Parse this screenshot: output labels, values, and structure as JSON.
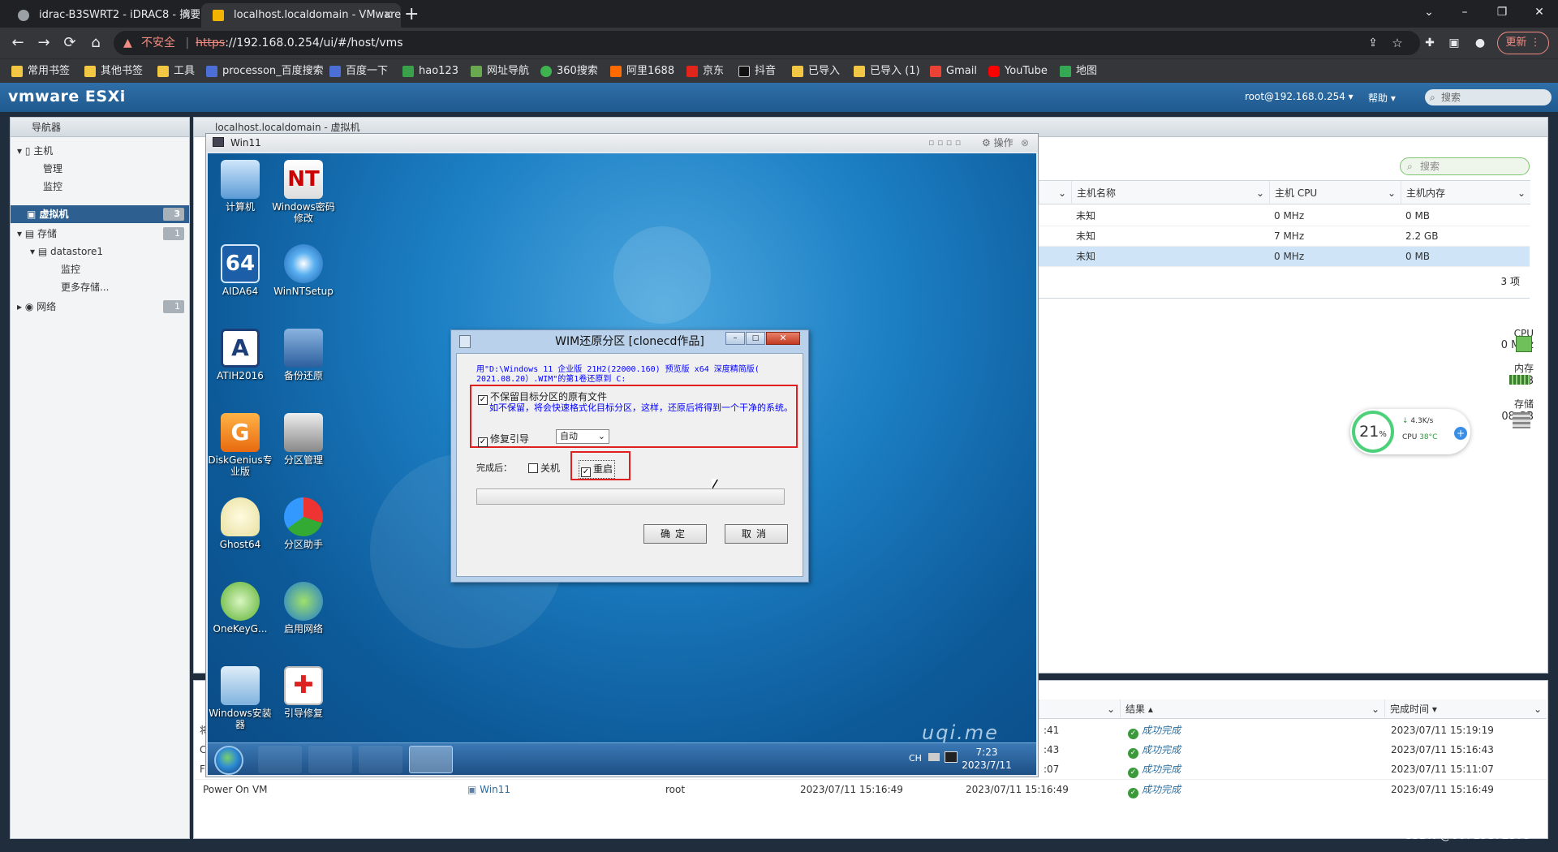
{
  "browser": {
    "tabs": [
      {
        "title": "idrac-B3SWRT2 - iDRAC8 - 摘要"
      },
      {
        "title": "localhost.localdomain - VMware ESXi"
      }
    ],
    "new_tab_label": "+",
    "window_controls": {
      "minimize": "–",
      "maximize": "❐",
      "close": "✕"
    },
    "nav": {
      "back": "←",
      "forward": "→",
      "reload": "⟳",
      "home": "⌂"
    },
    "address": {
      "security_label": "不安全",
      "scheme": "https",
      "url_rest": "://192.168.0.254/ui/#/host/vms"
    },
    "update_button": "更新",
    "bookmarks": [
      "常用书签",
      "其他书签",
      "工具",
      "processon_百度搜索",
      "百度一下",
      "hao123",
      "网址导航",
      "360搜索",
      "阿里1688",
      "京东",
      "抖音",
      "已导入",
      "已导入 (1)",
      "Gmail",
      "YouTube",
      "地图"
    ]
  },
  "esxi": {
    "logo": "vmware ESXi",
    "user": "root@192.168.0.254 ▾",
    "help": "帮助 ▾",
    "search_placeholder": "搜索",
    "navigator": {
      "title": "导航器",
      "items": [
        {
          "label": "主机"
        },
        {
          "label": "管理"
        },
        {
          "label": "监控"
        },
        {
          "label": "虚拟机",
          "badge": "3"
        },
        {
          "label": "存储",
          "badge": "1"
        },
        {
          "label": "datastore1"
        },
        {
          "label": "监控"
        },
        {
          "label": "更多存储..."
        },
        {
          "label": "网络",
          "badge": "1"
        }
      ]
    },
    "main_title": "localhost.localdomain - 虚拟机",
    "vm_search_placeholder": "搜索",
    "vm_table": {
      "headers": [
        "主机名称",
        "主机 CPU",
        "主机内存"
      ],
      "rows": [
        [
          "未知",
          "0 MHz",
          "0 MB"
        ],
        [
          "未知",
          "7 MHz",
          "2.2 GB"
        ],
        [
          "未知",
          "0 MHz",
          "0 MB"
        ]
      ],
      "count": "3 项"
    },
    "resources": {
      "cpu_label": "CPU",
      "cpu_value": "0 MHz",
      "mem_label": "内存",
      "mem_value": "0 B",
      "storage_label": "存储",
      "storage_value": "08 GB"
    },
    "widget": {
      "percent": "21",
      "percent_unit": "%",
      "speed": "4.3K/s",
      "cpu_temp_label": "CPU",
      "cpu_temp": "38°C"
    },
    "tasks": {
      "headers": {
        "result": "结果 ▴",
        "completed": "完成时间 ▾"
      },
      "rows": [
        {
          "c0": "将",
          "time_cut": ":41",
          "result": "成功完成",
          "completed": "2023/07/11 15:19:19"
        },
        {
          "c0": "C",
          "time_cut": ":43",
          "result": "成功完成",
          "completed": "2023/07/11 15:16:43"
        },
        {
          "c0": "Fi",
          "time_cut": ":07",
          "result": "成功完成",
          "completed": "2023/07/11 15:11:07"
        },
        {
          "task": "Power On VM",
          "target": "Win11",
          "initiator": "root",
          "queued": "2023/07/11 15:16:49",
          "started": "2023/07/11 15:16:49",
          "result": "成功完成",
          "completed": "2023/07/11 15:16:49"
        }
      ]
    }
  },
  "console": {
    "title": "Win11",
    "actions_label": "操作",
    "desktop_icons": [
      {
        "label": "计算机"
      },
      {
        "label": "Windows密码修改"
      },
      {
        "label": "AIDA64"
      },
      {
        "label": "WinNTSetup"
      },
      {
        "label": "ATIH2016"
      },
      {
        "label": "备份还原"
      },
      {
        "label": "DiskGenius专业版"
      },
      {
        "label": "分区管理"
      },
      {
        "label": "Ghost64"
      },
      {
        "label": "分区助手"
      },
      {
        "label": "OneKeyG..."
      },
      {
        "label": "启用网络"
      },
      {
        "label": "Windows安装器"
      },
      {
        "label": "引导修复"
      }
    ],
    "brand": "uqi.me",
    "tray": {
      "lang": "CH",
      "time": "7:23",
      "date": "2023/7/11"
    }
  },
  "dialog": {
    "title": "WIM还原分区 [clonecd作品]",
    "info": "用\"D:\\Windows 11 企业版 21H2(22000.160) 预览版 x64 深度精简版( 2021.08.20）.WIM\"的第1卷还原到 C:",
    "no_keep_label": "不保留目标分区的原有文件",
    "no_keep_desc": "如不保留，将会快速格式化目标分区，这样，还原后将得到一个干净的系统。",
    "fix_boot_label": "修复引导",
    "boot_mode": "自动",
    "after_label": "完成后：",
    "shutdown_label": "关机",
    "restart_label": "重启",
    "ok_label": "确定",
    "cancel_label": "取消"
  },
  "watermark": "CSDN @00719872579"
}
